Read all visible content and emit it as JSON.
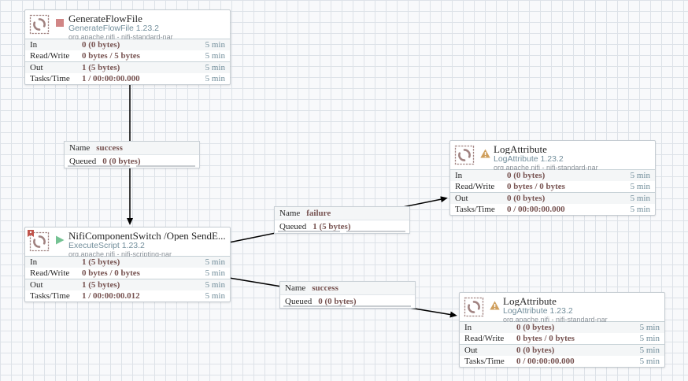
{
  "app": "Apache NiFi flow canvas",
  "colors": {
    "stat_value": "#775351",
    "stat_window": "#728e9b",
    "running_green": "#75c293",
    "stopped_red": "#d18686",
    "invalid_amber": "#cf9f5d",
    "icon_maroon": "#a08280"
  },
  "processors": [
    {
      "title": "GenerateFlowFile",
      "type": "GenerateFlowFile 1.23.2",
      "bundle": "org.apache.nifi - nifi-standard-nar",
      "state": "stopped",
      "stats": [
        {
          "label": "In",
          "value": "0 (0 bytes)",
          "window": "5 min"
        },
        {
          "label": "Read/Write",
          "value": "0 bytes / 5 bytes",
          "window": "5 min"
        },
        {
          "label": "Out",
          "value": "1 (5 bytes)",
          "window": "5 min"
        },
        {
          "label": "Tasks/Time",
          "value": "1 / 00:00:00.000",
          "window": "5 min"
        }
      ]
    },
    {
      "title": "NifiComponentSwitch /Open SendE...",
      "type": "ExecuteScript 1.23.2",
      "bundle": "org.apache.nifi - nifi-scripting-nar",
      "state": "running",
      "stats": [
        {
          "label": "In",
          "value": "1 (5 bytes)",
          "window": "5 min"
        },
        {
          "label": "Read/Write",
          "value": "0 bytes / 0 bytes",
          "window": "5 min"
        },
        {
          "label": "Out",
          "value": "1 (5 bytes)",
          "window": "5 min"
        },
        {
          "label": "Tasks/Time",
          "value": "1 / 00:00:00.012",
          "window": "5 min"
        }
      ]
    },
    {
      "title": "LogAttribute",
      "type": "LogAttribute 1.23.2",
      "bundle": "org.apache.nifi - nifi-standard-nar",
      "state": "invalid",
      "stats": [
        {
          "label": "In",
          "value": "0 (0 bytes)",
          "window": "5 min"
        },
        {
          "label": "Read/Write",
          "value": "0 bytes / 0 bytes",
          "window": "5 min"
        },
        {
          "label": "Out",
          "value": "0 (0 bytes)",
          "window": "5 min"
        },
        {
          "label": "Tasks/Time",
          "value": "0 / 00:00:00.000",
          "window": "5 min"
        }
      ]
    },
    {
      "title": "LogAttribute",
      "type": "LogAttribute 1.23.2",
      "bundle": "org.apache.nifi - nifi-standard-nar",
      "state": "invalid",
      "stats": [
        {
          "label": "In",
          "value": "0 (0 bytes)",
          "window": "5 min"
        },
        {
          "label": "Read/Write",
          "value": "0 bytes / 0 bytes",
          "window": "5 min"
        },
        {
          "label": "Out",
          "value": "0 (0 bytes)",
          "window": "5 min"
        },
        {
          "label": "Tasks/Time",
          "value": "0 / 00:00:00.000",
          "window": "5 min"
        }
      ]
    }
  ],
  "connections": [
    {
      "name_label": "Name",
      "name": "success",
      "queued_label": "Queued",
      "queued": "0 (0 bytes)"
    },
    {
      "name_label": "Name",
      "name": "failure",
      "queued_label": "Queued",
      "queued": "1 (5 bytes)"
    },
    {
      "name_label": "Name",
      "name": "success",
      "queued_label": "Queued",
      "queued": "0 (0 bytes)"
    }
  ]
}
